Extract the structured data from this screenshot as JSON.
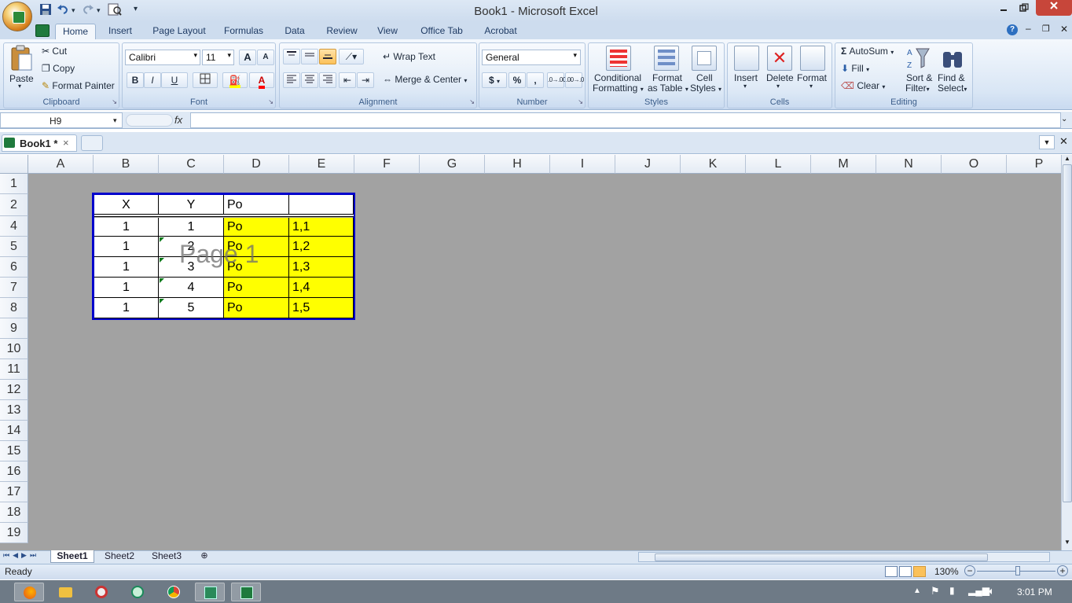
{
  "window": {
    "title": "Book1 - Microsoft Excel"
  },
  "qat": {
    "dropdown": "▾"
  },
  "ribbon_tabs": [
    "Home",
    "Insert",
    "Page Layout",
    "Formulas",
    "Data",
    "Review",
    "View",
    "Office Tab",
    "Acrobat"
  ],
  "clipboard": {
    "paste": "Paste",
    "cut": "Cut",
    "copy": "Copy",
    "format_painter": "Format Painter",
    "label": "Clipboard"
  },
  "font": {
    "name": "Calibri",
    "size": "11",
    "bold": "B",
    "italic": "I",
    "underline": "U",
    "label": "Font",
    "grow": "A",
    "shrink": "A",
    "color": "A"
  },
  "alignment": {
    "wrap": "Wrap Text",
    "merge": "Merge & Center",
    "label": "Alignment"
  },
  "number": {
    "format": "General",
    "currency": "$",
    "percent": "%",
    "comma": ",",
    "inc": ".0→.00",
    "dec": ".00→.0",
    "label": "Number"
  },
  "styles": {
    "conditional": [
      "Conditional",
      "Formatting"
    ],
    "table": [
      "Format",
      "as Table"
    ],
    "cell": [
      "Cell",
      "Styles"
    ],
    "label": "Styles"
  },
  "cells": {
    "insert": "Insert",
    "delete": "Delete",
    "format": "Format",
    "label": "Cells"
  },
  "editing": {
    "autosum": "AutoSum",
    "fill": "Fill",
    "clear": "Clear",
    "sort": [
      "Sort &",
      "Filter"
    ],
    "find": [
      "Find &",
      "Select"
    ],
    "label": "Editing"
  },
  "formula_bar": {
    "name_box": "H9",
    "fx": "fx",
    "value": ""
  },
  "doc_tab": {
    "name": "Book1 *",
    "close": "×"
  },
  "columns": [
    "A",
    "B",
    "C",
    "D",
    "E",
    "F",
    "G",
    "H",
    "I",
    "J",
    "K",
    "L",
    "M",
    "N",
    "O",
    "P"
  ],
  "rows": [
    "1",
    "2",
    "4",
    "5",
    "6",
    "7",
    "8",
    "9",
    "10",
    "11",
    "12",
    "13",
    "14",
    "15",
    "16",
    "17",
    "18",
    "19"
  ],
  "table": {
    "header": [
      "X",
      "Y",
      "Po",
      ""
    ],
    "rows": [
      [
        "1",
        "1",
        "Po",
        "1,1"
      ],
      [
        "1",
        "2",
        "Po",
        "1,2"
      ],
      [
        "1",
        "3",
        "Po",
        "1,3"
      ],
      [
        "1",
        "4",
        "Po",
        "1,4"
      ],
      [
        "1",
        "5",
        "Po",
        "1,5"
      ]
    ],
    "highlight_color": "#ffff00",
    "border_color": "#0000cc"
  },
  "watermark": "Page 1",
  "sheets": [
    "Sheet1",
    "Sheet2",
    "Sheet3"
  ],
  "status": {
    "text": "Ready",
    "zoom": "130%"
  },
  "taskbar": {
    "time": "3:01 PM"
  }
}
